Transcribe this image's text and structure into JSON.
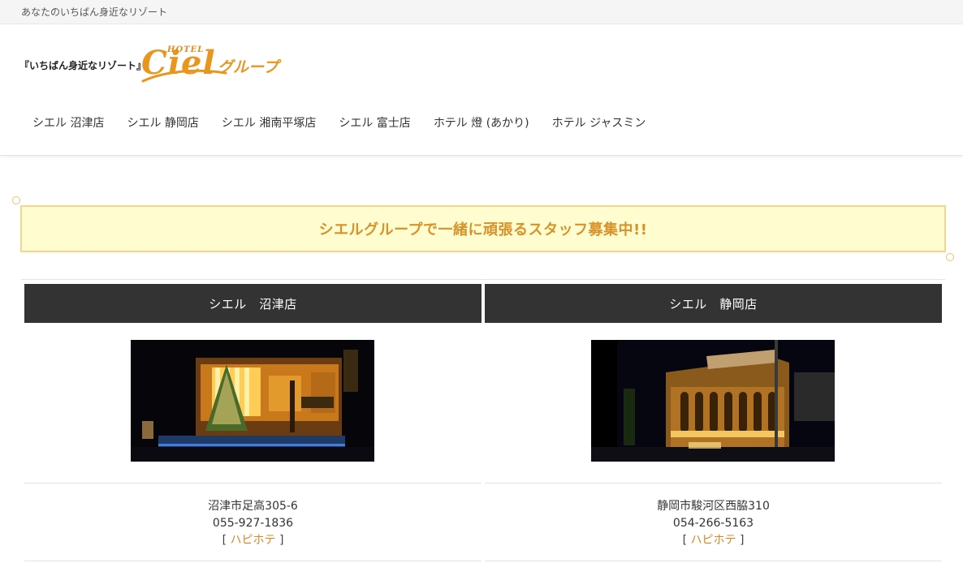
{
  "topbar": {
    "tagline": "あなたのいちばん身近なリゾート"
  },
  "logo": {
    "subtitle": "『いちばん身近なリゾート』",
    "hotel": "HOTEL",
    "brand": "Ciel",
    "group": "グループ"
  },
  "nav": {
    "items": [
      {
        "label": "シエル 沼津店"
      },
      {
        "label": "シエル 静岡店"
      },
      {
        "label": "シエル 湘南平塚店"
      },
      {
        "label": "シエル 富士店"
      },
      {
        "label": "ホテル 燈 (あかり)"
      },
      {
        "label": "ホテル ジャスミン"
      }
    ]
  },
  "banner": {
    "text": "シエルグループで一緒に頑張るスタッフ募集中!!"
  },
  "stores": [
    {
      "title": "シエル　沼津店",
      "address": "沼津市足高305-6",
      "phone": "055-927-1836",
      "bracket_open": "[",
      "link": "ハピホテ",
      "bracket_close": "]"
    },
    {
      "title": "シエル　静岡店",
      "address": "静岡市駿河区西脇310",
      "phone": "054-266-5163",
      "bracket_open": "[",
      "link": "ハピホテ",
      "bracket_close": "]"
    }
  ],
  "colors": {
    "accent": "#e8961e",
    "banner_bg": "#fffcd0",
    "banner_border": "#f5d58a",
    "header_dark": "#333333",
    "link": "#d08a2a"
  }
}
